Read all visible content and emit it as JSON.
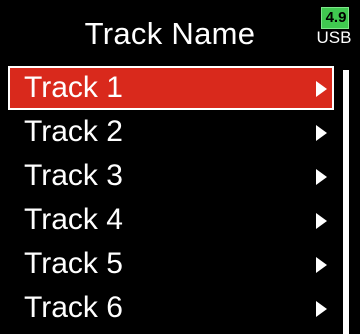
{
  "header": {
    "title": "Track Name"
  },
  "status": {
    "battery_value": "4.9",
    "power_source": "USB",
    "battery_color": "#40c850"
  },
  "tracks": [
    {
      "label": "Track 1",
      "selected": true
    },
    {
      "label": "Track 2",
      "selected": false
    },
    {
      "label": "Track 3",
      "selected": false
    },
    {
      "label": "Track 4",
      "selected": false
    },
    {
      "label": "Track 5",
      "selected": false
    },
    {
      "label": "Track 6",
      "selected": false
    }
  ],
  "colors": {
    "selection": "#d9291c",
    "background": "#000000",
    "text": "#ffffff"
  },
  "icons": {
    "row_arrow": "chevron-right-icon",
    "battery": "battery-icon"
  }
}
